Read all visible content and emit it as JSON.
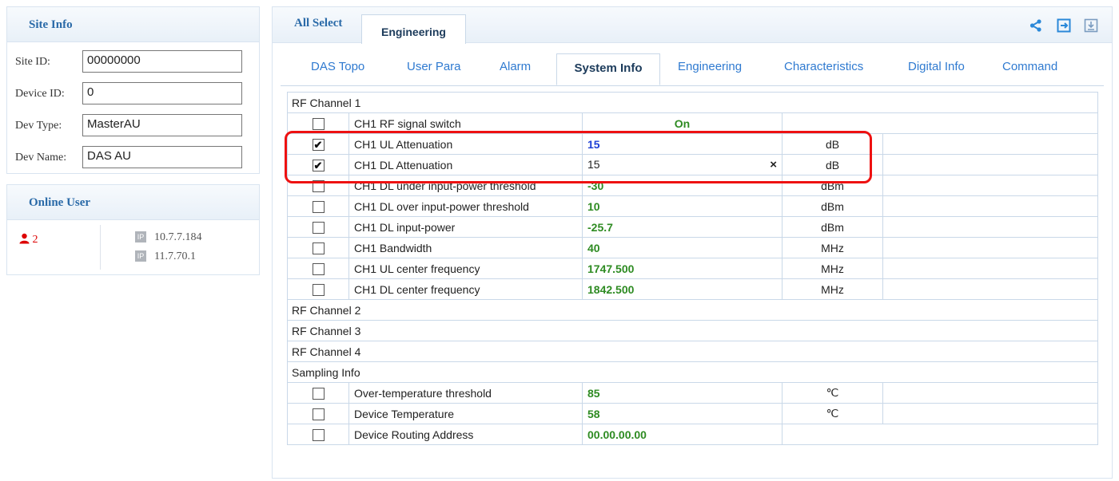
{
  "site_info": {
    "title": "Site Info",
    "fields": [
      {
        "label": "Site ID:",
        "value": "00000000"
      },
      {
        "label": "Device ID:",
        "value": "0"
      },
      {
        "label": "Dev Type:",
        "value": "MasterAU"
      },
      {
        "label": "Dev Name:",
        "value": "DAS AU"
      }
    ]
  },
  "online_user": {
    "title": "Online User",
    "count": "2",
    "ips": [
      "10.7.7.184",
      "11.7.70.1"
    ],
    "ip_badge": "IP"
  },
  "top_tabs": {
    "all_select": "All Select",
    "engineering": "Engineering"
  },
  "toolbar_icons": [
    "share-icon",
    "export-icon",
    "download-icon"
  ],
  "sub_tabs": [
    "DAS Topo",
    "User Para",
    "Alarm",
    "System Info",
    "Engineering",
    "Characteristics",
    "Digital Info",
    "Command"
  ],
  "active_sub_tab": "System Info",
  "table": {
    "sections": {
      "rf1": "RF Channel 1",
      "rf2": "RF Channel 2",
      "rf3": "RF Channel 3",
      "rf4": "RF Channel 4",
      "sampling": "Sampling Info"
    },
    "rf1_rows": [
      {
        "checked": false,
        "name": "CH1 RF signal switch",
        "value": "On",
        "unit": ""
      },
      {
        "checked": true,
        "name": "CH1 UL Attenuation",
        "value": "15",
        "unit": "dB"
      },
      {
        "checked": true,
        "name": "CH1 DL Attenuation",
        "value": "15",
        "unit": "dB"
      },
      {
        "checked": false,
        "name": "CH1 DL under input-power threshold",
        "value": "-30",
        "unit": "dBm"
      },
      {
        "checked": false,
        "name": "CH1 DL over input-power threshold",
        "value": "10",
        "unit": "dBm"
      },
      {
        "checked": false,
        "name": "CH1 DL input-power",
        "value": "-25.7",
        "unit": "dBm"
      },
      {
        "checked": false,
        "name": "CH1 Bandwidth",
        "value": "40",
        "unit": "MHz"
      },
      {
        "checked": false,
        "name": "CH1 UL center frequency",
        "value": "1747.500",
        "unit": "MHz"
      },
      {
        "checked": false,
        "name": "CH1 DL center frequency",
        "value": "1842.500",
        "unit": "MHz"
      }
    ],
    "sampling_rows": [
      {
        "checked": false,
        "name": "Over-temperature threshold",
        "value": "85",
        "unit": "℃"
      },
      {
        "checked": false,
        "name": "Device Temperature",
        "value": "58",
        "unit": "℃"
      },
      {
        "checked": false,
        "name": "Device Routing Address",
        "value": "00.00.00.00",
        "unit": ""
      }
    ],
    "clear_glyph": "×",
    "check_glyph": "✔"
  },
  "colors": {
    "accent_blue": "#2a6aa8",
    "value_green": "#2e8b22",
    "value_blue": "#1d3fd6",
    "highlight_red": "#e11",
    "user_red": "#d00"
  }
}
